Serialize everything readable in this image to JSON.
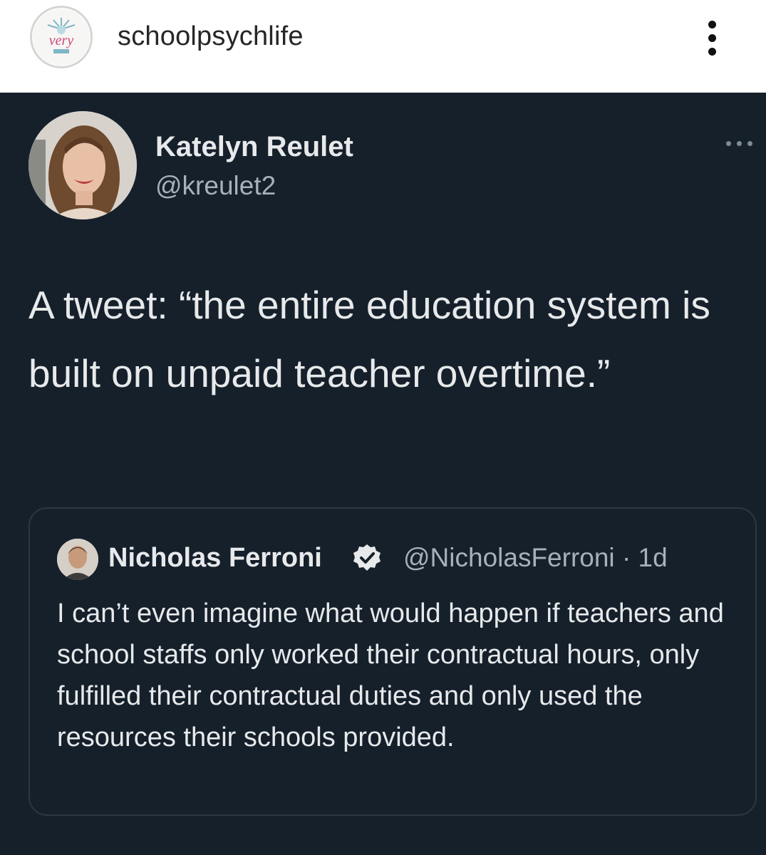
{
  "instagram": {
    "username": "schoolpsychlife",
    "avatar_text": "very"
  },
  "tweet": {
    "author_name": "Katelyn Reulet",
    "author_handle": "@kreulet2",
    "text": "A tweet: “the entire education system is built on unpaid teacher overtime.”"
  },
  "quoted_tweet": {
    "author_name": "Nicholas Ferroni",
    "author_handle": "@NicholasFerroni",
    "separator": "·",
    "time": "1d",
    "text": "I can’t even imagine what would happen if teachers and school staffs only worked their contractual hours, only fulfilled their contractual duties and only used the resources their schools provided."
  },
  "colors": {
    "background": "#15202b",
    "text_primary": "#e7e9ea",
    "text_secondary": "#a8b0b8",
    "quote_border": "#2c3740"
  }
}
